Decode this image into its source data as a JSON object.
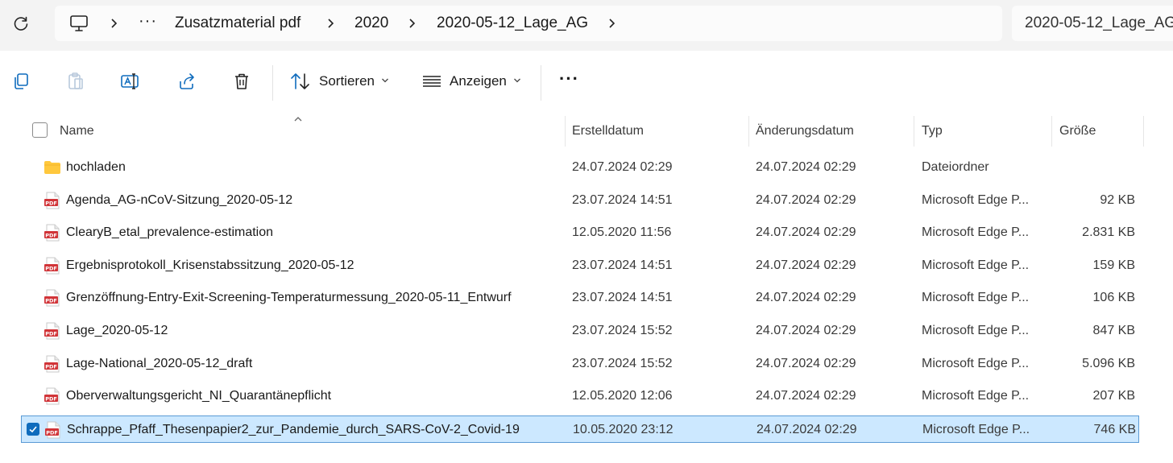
{
  "breadcrumb": {
    "items": [
      "Zusatzmaterial pdf",
      "2020",
      "2020-05-12_Lage_AG"
    ],
    "overflow": "···"
  },
  "search": {
    "text": "2020-05-12_Lage_AG"
  },
  "toolbar": {
    "sort_label": "Sortieren",
    "view_label": "Anzeigen",
    "more_label": "···"
  },
  "columns": {
    "name": "Name",
    "created": "Erstelldatum",
    "modified": "Änderungsdatum",
    "type": "Typ",
    "size": "Größe"
  },
  "rows": [
    {
      "name": "hochladen",
      "created": "24.07.2024 02:29",
      "modified": "24.07.2024 02:29",
      "type": "Dateiordner",
      "size": "",
      "icon": "folder-icon",
      "selected": false
    },
    {
      "name": "Agenda_AG-nCoV-Sitzung_2020-05-12",
      "created": "23.07.2024 14:51",
      "modified": "24.07.2024 02:29",
      "type": "Microsoft Edge P...",
      "size": "92 KB",
      "icon": "pdf-icon",
      "selected": false
    },
    {
      "name": "ClearyB_etal_prevalence-estimation",
      "created": "12.05.2020 11:56",
      "modified": "24.07.2024 02:29",
      "type": "Microsoft Edge P...",
      "size": "2.831 KB",
      "icon": "pdf-icon",
      "selected": false
    },
    {
      "name": "Ergebnisprotokoll_Krisenstabssitzung_2020-05-12",
      "created": "23.07.2024 14:51",
      "modified": "24.07.2024 02:29",
      "type": "Microsoft Edge P...",
      "size": "159 KB",
      "icon": "pdf-icon",
      "selected": false
    },
    {
      "name": "Grenzöffnung-Entry-Exit-Screening-Temperaturmessung_2020-05-11_Entwurf",
      "created": "23.07.2024 14:51",
      "modified": "24.07.2024 02:29",
      "type": "Microsoft Edge P...",
      "size": "106 KB",
      "icon": "pdf-icon",
      "selected": false
    },
    {
      "name": "Lage_2020-05-12",
      "created": "23.07.2024 15:52",
      "modified": "24.07.2024 02:29",
      "type": "Microsoft Edge P...",
      "size": "847 KB",
      "icon": "pdf-icon",
      "selected": false
    },
    {
      "name": "Lage-National_2020-05-12_draft",
      "created": "23.07.2024 15:52",
      "modified": "24.07.2024 02:29",
      "type": "Microsoft Edge P...",
      "size": "5.096 KB",
      "icon": "pdf-icon",
      "selected": false
    },
    {
      "name": "Oberverwaltungsgericht_NI_Quarantänepflicht",
      "created": "12.05.2020 12:06",
      "modified": "24.07.2024 02:29",
      "type": "Microsoft Edge P...",
      "size": "207 KB",
      "icon": "pdf-icon",
      "selected": false
    },
    {
      "name": "Schrappe_Pfaff_Thesenpapier2_zur_Pandemie_durch_SARS-CoV-2_Covid-19",
      "created": "10.05.2020 23:12",
      "modified": "24.07.2024 02:29",
      "type": "Microsoft Edge P...",
      "size": "746 KB",
      "icon": "pdf-icon",
      "selected": true
    }
  ],
  "pdf_badge": "PDF",
  "colors": {
    "selection_bg": "#cce8ff",
    "selection_border": "#5b9bd5",
    "accent": "#0f6cbd",
    "pdf_red": "#d13438",
    "folder_yellow": "#ffc83d"
  }
}
